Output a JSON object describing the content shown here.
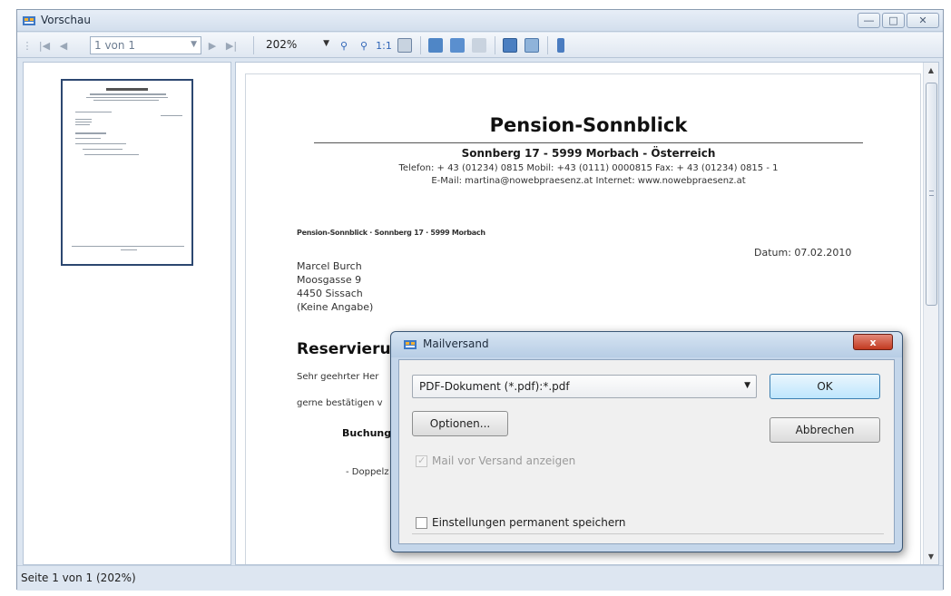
{
  "window": {
    "title": "Vorschau"
  },
  "toolbar": {
    "page_selector_value": "1 von 1",
    "zoom_value": "202%",
    "actual_size_label": "1:1"
  },
  "document": {
    "title": "Pension-Sonnblick",
    "subtitle": "Sonnberg 17 - 5999 Morbach - Österreich",
    "contact_line": "Telefon: + 43 (01234) 0815 Mobil: +43 (0111) 0000815 Fax: + 43 (01234) 0815 - 1",
    "email_line": "E-Mail: martina@nowebpraesenz.at Internet: www.nowebpraesenz.at",
    "sender_line": "Pension-Sonnblick · Sonnberg 17 · 5999 Morbach",
    "date": "Datum: 07.02.2010",
    "recipient": {
      "name": "Marcel Burch",
      "street": "Moosgasse 9",
      "city": "4450 Sissach",
      "extra": "(Keine Angabe)"
    },
    "heading": "Reservierun",
    "salutation": "Sehr geehrter Her",
    "body_start": "gerne bestätigen v",
    "booking_heading": "Buchungs",
    "bullet_item": "-   Doppelz"
  },
  "status": {
    "text": "Seite 1 von 1 (202%)"
  },
  "dialog": {
    "title": "Mailversand",
    "format_value": "PDF-Dokument (*.pdf):*.pdf",
    "options_label": "Optionen...",
    "ok_label": "OK",
    "cancel_label": "Abbrechen",
    "show_mail_label": "Mail vor Versand anzeigen",
    "show_mail_checked": true,
    "show_mail_enabled": false,
    "save_settings_label": "Einstellungen permanent speichern",
    "save_settings_checked": false,
    "close_glyph": "x"
  },
  "colors": {
    "accent_blue": "#2f65b7",
    "dialog_close_red": "#c23a20",
    "default_button": "#bee6fd"
  }
}
